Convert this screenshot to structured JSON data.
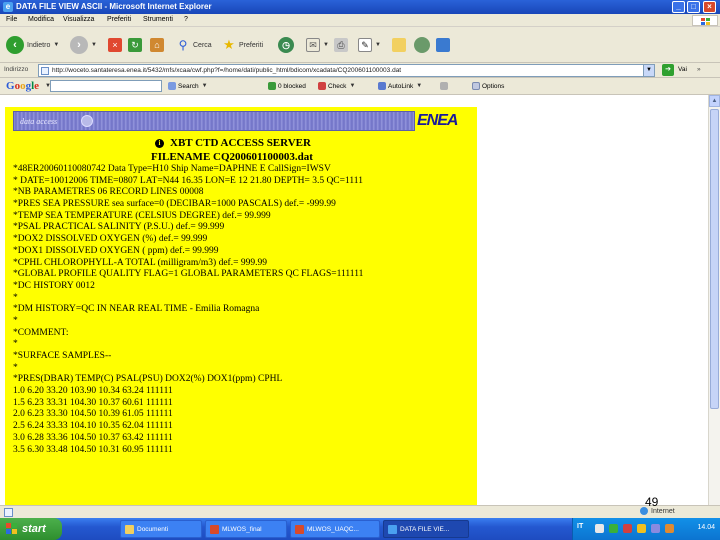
{
  "window": {
    "title": "DATA FILE VIEW ASCII - Microsoft Internet Explorer",
    "minimize": "_",
    "maximize": "□",
    "close": "×"
  },
  "menu": [
    "File",
    "Modifica",
    "Visualizza",
    "Preferiti",
    "Strumenti",
    "?"
  ],
  "toolbar": {
    "back": "Indietro",
    "search": "Cerca",
    "favorites": "Preferiti"
  },
  "address": {
    "label": "Indirizzo",
    "url": "http://woceto.santateresa.enea.it/5432/mfs/xcaa/cwf.php?f=/home/dati/public_html/bdicom/xcadata/CQ200601100003.dat",
    "go": "Vai",
    "links": "»"
  },
  "google": {
    "logo": [
      "G",
      "o",
      "o",
      "g",
      "l",
      "e"
    ],
    "logo_colors": [
      "#2a5bd7",
      "#d62d20",
      "#e8a317",
      "#2a5bd7",
      "#008744",
      "#d62d20"
    ],
    "search": "Search",
    "blocked": "0 blocked",
    "check": "Check",
    "autolink": "AutoLink",
    "options": "Options"
  },
  "page": {
    "banner_text": "data access",
    "logo": "ENEA",
    "server_title": "XBT CTD ACCESS SERVER",
    "filename": "FILENAME    CQ200601100003.dat",
    "lines": [
      "*48ER20060110080742 Data Type=H10 Ship Name=DAPHNE E CallSign=IWSV",
      "* DATE=10012006 TIME=0807 LAT=N44 16.35 LON=E 12 21.80 DEPTH=  3.5 QC=1111",
      "*NB PARAMETRES   06 RECORD LINES   00008",
      "*PRES SEA PRESSURE sea surface=0 (DECIBAR=1000 PASCALS)  def.= -999.99",
      "*TEMP SEA TEMPERATURE (CELSIUS DEGREE) def.= 99.999",
      "*PSAL PRACTICAL SALINITY (P.S.U.) def.= 99.999",
      "*DOX2 DISSOLVED OXYGEN (%) def.= 99.999",
      "*DOX1 DISSOLVED OXYGEN ( ppm) def.= 99.999",
      "*CPHL CHLOROPHYLL-A TOTAL (milligram/m3) def.= 999.99",
      "*GLOBAL PROFILE QUALITY FLAG=1 GLOBAL PARAMETERS QC FLAGS=111111",
      "*DC HISTORY  0012",
      "*",
      "*DM HISTORY=QC IN NEAR REAL TIME - Emilia Romagna",
      "*",
      "*COMMENT:",
      "*",
      "*SURFACE SAMPLES--",
      "*",
      "*PRES(DBAR) TEMP(C) PSAL(PSU) DOX2(%) DOX1(ppm) CPHL",
      "1.0 6.20 33.20 103.90 10.34 63.24 111111",
      "1.5 6.23 33.31 104.30 10.37 60.61 111111",
      "2.0 6.23 33.30 104.50 10.39 61.05 111111",
      "2.5 6.24 33.33 104.10 10.35 62.04 111111",
      "3.0 6.28 33.36 104.50 10.37 63.42 111111",
      "3.5 6.30 33.48 104.50 10.31 60.95 111111"
    ]
  },
  "status": {
    "zone": "Internet",
    "page_number": "49"
  },
  "taskbar": {
    "start": "start",
    "tasks": [
      "Documenti",
      "MLWOS_final",
      "MLWOS_UAQC...",
      "DATA FILE VIE..."
    ],
    "lang": "IT",
    "clock": "14.04"
  }
}
